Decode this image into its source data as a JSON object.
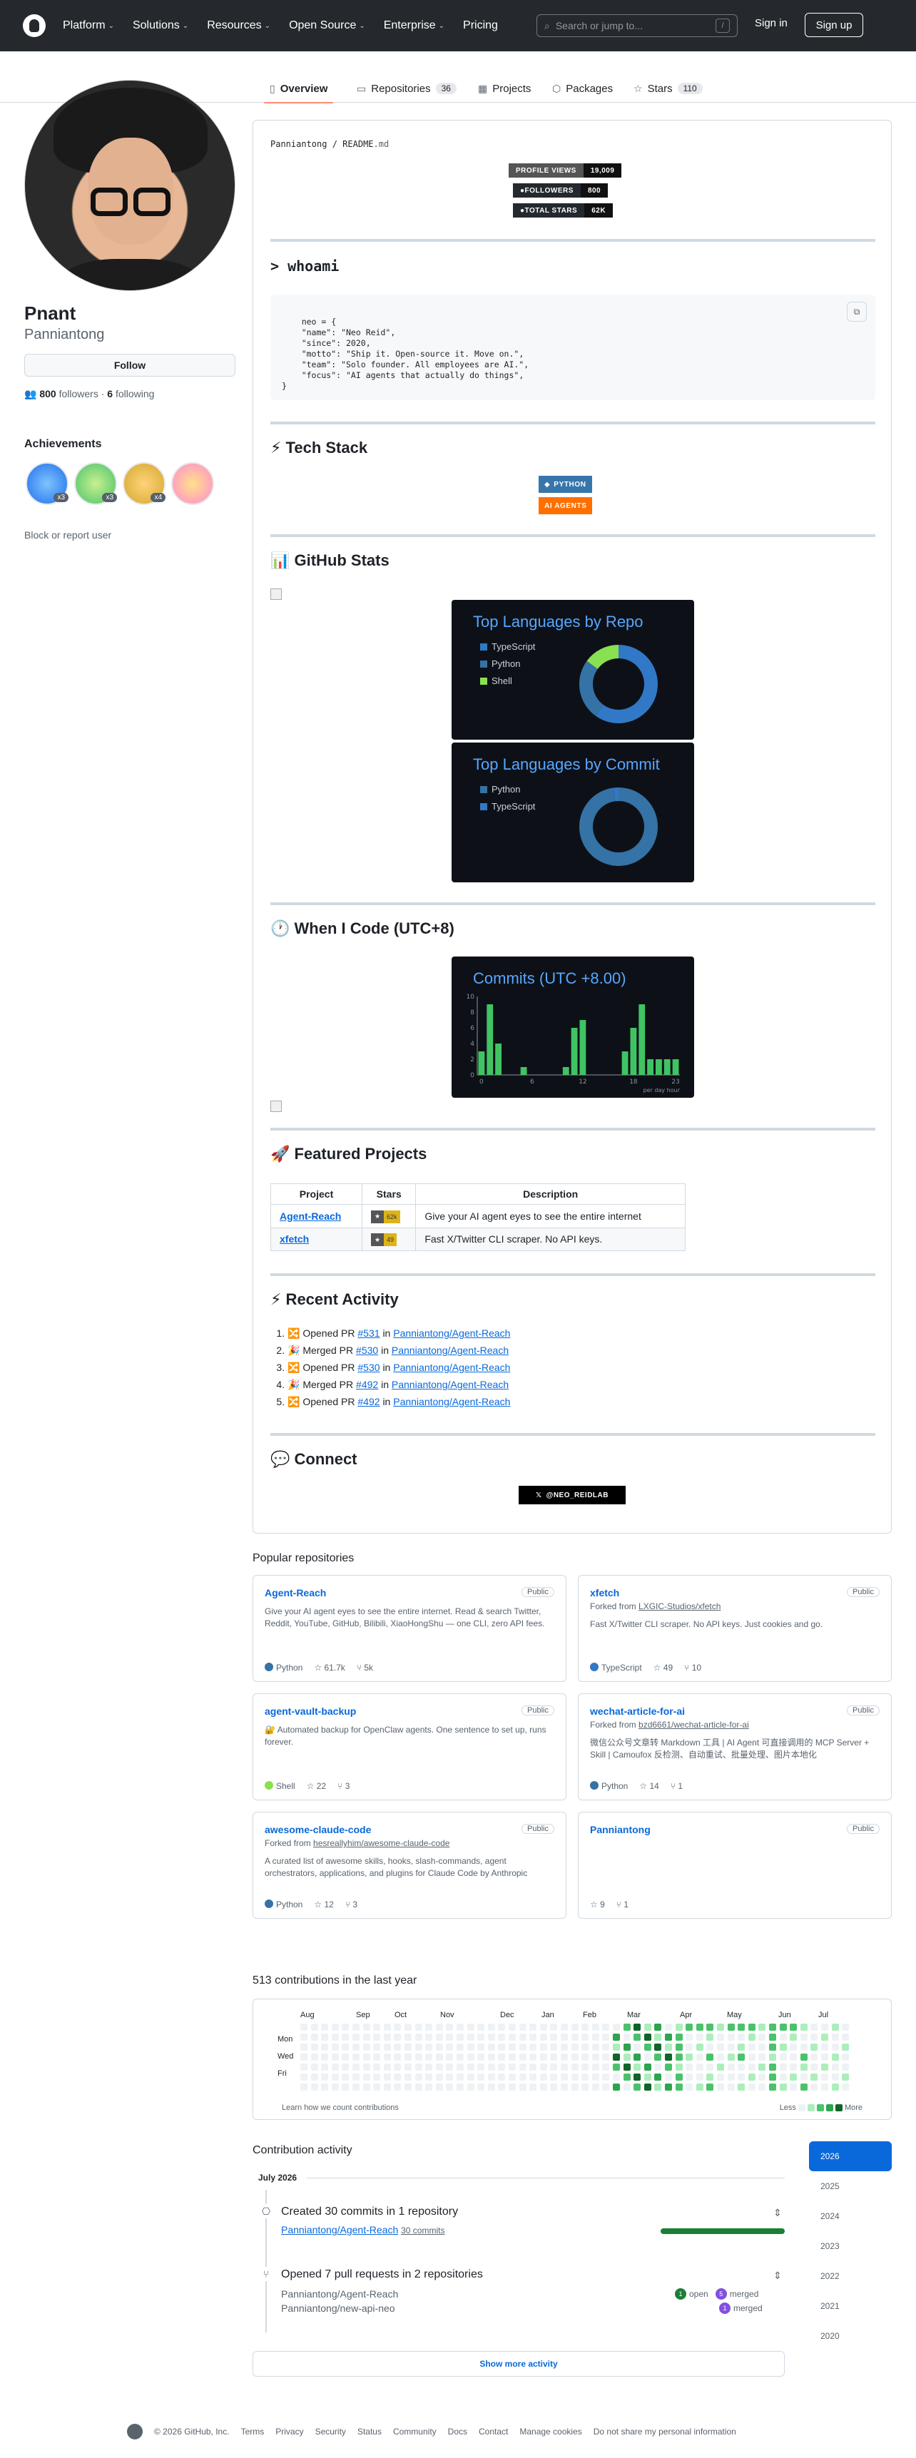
{
  "header": {
    "nav": [
      "Platform",
      "Solutions",
      "Resources",
      "Open Source",
      "Enterprise",
      "Pricing"
    ],
    "search_placeholder": "Search or jump to...",
    "search_shortcut": "/",
    "signin": "Sign in",
    "signup": "Sign up"
  },
  "tabs": [
    {
      "label": "Overview",
      "count": ""
    },
    {
      "label": "Repositories",
      "count": "36"
    },
    {
      "label": "Projects",
      "count": ""
    },
    {
      "label": "Packages",
      "count": ""
    },
    {
      "label": "Stars",
      "count": "110"
    }
  ],
  "profile": {
    "name": "Pnant",
    "login": "Panniantong",
    "follow": "Follow",
    "followers": "800",
    "followers_label": "followers",
    "following": "6",
    "following_label": "following",
    "achievements_title": "Achievements",
    "achievements": [
      {
        "icon": "pull-shark-icon",
        "count": "x3"
      },
      {
        "icon": "starstruck-icon",
        "count": "x3"
      },
      {
        "icon": "pair-extraordinaire-icon",
        "count": "x4"
      },
      {
        "icon": "yolo-icon",
        "count": ""
      }
    ],
    "block": "Block or report user"
  },
  "readme": {
    "path_user": "Panniantong",
    "path_sep": " / ",
    "path_file": "README",
    "path_ext": ".md",
    "stat_badges": [
      {
        "label": "PROFILE VIEWS",
        "value": "19,009"
      },
      {
        "label": "FOLLOWERS",
        "value": "800"
      },
      {
        "label": "TOTAL STARS",
        "value": "62K"
      }
    ],
    "whoami_title": "> whoami",
    "code": "neo = {\n    \"name\": \"Neo Reid\",\n    \"since\": 2020,\n    \"motto\": \"Ship it. Open-source it. Move on.\",\n    \"team\": \"Solo founder. All employees are AI.\",\n    \"focus\": \"AI agents that actually do things\",\n}",
    "tech_title": "⚡ Tech Stack",
    "tech_badges": [
      {
        "label": "PYTHON",
        "color": "#3776ab"
      },
      {
        "label": "AI AGENTS",
        "color": "#ff6f00"
      }
    ],
    "stats_title": "📊 GitHub Stats",
    "lang_repo": {
      "title": "Top Languages by Repo",
      "legend": [
        {
          "name": "TypeScript",
          "color": "#3178c6"
        },
        {
          "name": "Python",
          "color": "#3572a5"
        },
        {
          "name": "Shell",
          "color": "#89e051"
        }
      ],
      "values": [
        60,
        25,
        15
      ]
    },
    "lang_commit": {
      "title": "Top Languages by Commit",
      "legend": [
        {
          "name": "Python",
          "color": "#3572a5"
        },
        {
          "name": "TypeScript",
          "color": "#3178c6"
        }
      ],
      "values": [
        98,
        2
      ]
    },
    "code_title": "🕐 When I Code (UTC+8)",
    "featured_title": "🚀 Featured Projects",
    "featured_headers": [
      "Project",
      "Stars",
      "Description"
    ],
    "featured": [
      {
        "name": "Agent-Reach",
        "stars": "62k",
        "desc": "Give your AI agent eyes to see the entire internet"
      },
      {
        "name": "xfetch",
        "stars": "49",
        "desc": "Fast X/Twitter CLI scraper. No API keys."
      }
    ],
    "recent_title": "⚡ Recent Activity",
    "recent": [
      {
        "icon": "🔀",
        "verb": "Opened PR",
        "pr": "#531",
        "in": "in",
        "repo": "Panniantong/Agent-Reach"
      },
      {
        "icon": "🎉",
        "verb": "Merged PR",
        "pr": "#530",
        "in": "in",
        "repo": "Panniantong/Agent-Reach"
      },
      {
        "icon": "🔀",
        "verb": "Opened PR",
        "pr": "#530",
        "in": "in",
        "repo": "Panniantong/Agent-Reach"
      },
      {
        "icon": "🎉",
        "verb": "Merged PR",
        "pr": "#492",
        "in": "in",
        "repo": "Panniantong/Agent-Reach"
      },
      {
        "icon": "🔀",
        "verb": "Opened PR",
        "pr": "#492",
        "in": "in",
        "repo": "Panniantong/Agent-Reach"
      }
    ],
    "connect_title": "💬 Connect",
    "x_badge": "@NEO_REIDLAB"
  },
  "chart_data": {
    "type": "bar",
    "title": "Commits (UTC +8.00)",
    "xlabel": "per day hour",
    "categories": [
      "0",
      "1",
      "2",
      "3",
      "4",
      "5",
      "6",
      "7",
      "8",
      "9",
      "10",
      "11",
      "12",
      "13",
      "14",
      "15",
      "16",
      "17",
      "18",
      "19",
      "20",
      "21",
      "22",
      "23"
    ],
    "values": [
      3,
      9,
      4,
      0,
      0,
      1,
      0,
      0,
      0,
      0,
      1,
      6,
      7,
      0,
      0,
      0,
      0,
      3,
      6,
      9,
      2,
      2,
      2,
      2
    ],
    "ylim": [
      0,
      10
    ],
    "yticks": [
      0,
      2,
      4,
      6,
      8,
      10
    ],
    "xticks": [
      "0",
      "6",
      "12",
      "18",
      "23"
    ],
    "bar_color": "#40c463"
  },
  "popular_title": "Popular repositories",
  "repos": [
    {
      "name": "Agent-Reach",
      "visibility": "Public",
      "fork_prefix": "",
      "fork_from": "",
      "desc": "Give your AI agent eyes to see the entire internet. Read & search Twitter, Reddit, YouTube, GitHub, Bilibili, XiaoHongShu — one CLI, zero API fees.",
      "lang": "Python",
      "lang_color": "#3572a5",
      "stars": "61.7k",
      "forks": "5k"
    },
    {
      "name": "xfetch",
      "visibility": "Public",
      "fork_prefix": "Forked from ",
      "fork_from": "LXGIC-Studios/xfetch",
      "desc": "Fast X/Twitter CLI scraper. No API keys. Just cookies and go.",
      "lang": "TypeScript",
      "lang_color": "#3178c6",
      "stars": "49",
      "forks": "10"
    },
    {
      "name": "agent-vault-backup",
      "visibility": "Public",
      "fork_prefix": "",
      "fork_from": "",
      "desc": "🔐 Automated backup for OpenClaw agents. One sentence to set up, runs forever.",
      "lang": "Shell",
      "lang_color": "#89e051",
      "stars": "22",
      "forks": "3"
    },
    {
      "name": "wechat-article-for-ai",
      "visibility": "Public",
      "fork_prefix": "Forked from ",
      "fork_from": "bzd6661/wechat-article-for-ai",
      "desc": "微信公众号文章转 Markdown 工具 | AI Agent 可直接调用的 MCP Server + Skill | Camoufox 反检测、自动重试、批量处理、图片本地化",
      "lang": "Python",
      "lang_color": "#3572a5",
      "stars": "14",
      "forks": "1"
    },
    {
      "name": "awesome-claude-code",
      "visibility": "Public",
      "fork_prefix": "Forked from ",
      "fork_from": "hesreallyhim/awesome-claude-code",
      "desc": "A curated list of awesome skills, hooks, slash-commands, agent orchestrators, applications, and plugins for Claude Code by Anthropic",
      "lang": "Python",
      "lang_color": "#3572a5",
      "stars": "12",
      "forks": "3"
    },
    {
      "name": "Panniantong",
      "visibility": "Public",
      "fork_prefix": "",
      "fork_from": "",
      "desc": "",
      "lang": "",
      "lang_color": "",
      "stars": "9",
      "forks": "1"
    }
  ],
  "contrib": {
    "title": "513 contributions in the last year",
    "months": [
      "Aug",
      "Sep",
      "Oct",
      "Nov",
      "Dec",
      "Jan",
      "Feb",
      "Mar",
      "Apr",
      "May",
      "Jun",
      "Jul"
    ],
    "days": [
      "Mon",
      "Wed",
      "Fri"
    ],
    "learn": "Learn how we count contributions",
    "less": "Less",
    "more": "More",
    "levels": [
      "#eff2f5",
      "#aceebb",
      "#4ac26b",
      "#2da44e",
      "#116329"
    ]
  },
  "activity": {
    "title": "Contribution activity",
    "years": [
      "2026",
      "2025",
      "2024",
      "2023",
      "2022",
      "2021",
      "2020"
    ],
    "month": "July 2026",
    "commits_title": "Created 30 commits in 1 repository",
    "commits_repo": "Panniantong/Agent-Reach",
    "commits_count": "30 commits",
    "pr_title": "Opened 7 pull requests in 2 repositories",
    "pr_rows": [
      {
        "repo": "Panniantong/Agent-Reach",
        "open": "1",
        "open_label": "open",
        "merged": "5",
        "merged_label": "merged"
      },
      {
        "repo": "Panniantong/new-api-neo",
        "open": "",
        "open_label": "",
        "merged": "1",
        "merged_label": "merged"
      }
    ],
    "show_more": "Show more activity"
  },
  "footer": [
    "© 2026 GitHub, Inc.",
    "Terms",
    "Privacy",
    "Security",
    "Status",
    "Community",
    "Docs",
    "Contact",
    "Manage cookies",
    "Do not share my personal information"
  ]
}
